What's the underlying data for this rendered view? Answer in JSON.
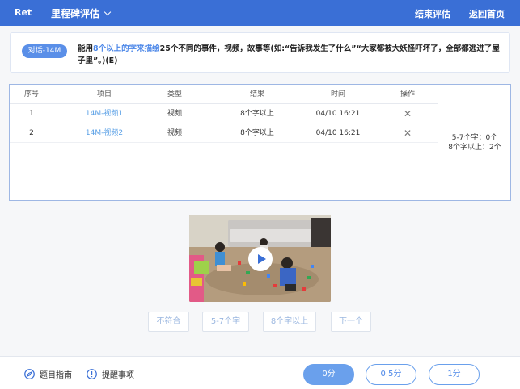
{
  "topbar": {
    "brand": "Ret",
    "menu": "里程碑评估",
    "end": "结束评估",
    "home": "返回首页"
  },
  "question": {
    "tag": "对话-14M",
    "text_pre": "能用",
    "text_hl": "8个以上的字来描绘",
    "text_post": "25个不同的事件，视频，故事等(如:“告诉我发生了什么”“大家都被大妖怪吓坏了，全部都逃进了屋子里”。)(E)"
  },
  "table": {
    "headers": [
      "序号",
      "项目",
      "类型",
      "结果",
      "时间",
      "操作"
    ],
    "rows": [
      {
        "no": "1",
        "item": "14M-视频1",
        "type": "视频",
        "result": "8个字以上",
        "time": "04/10 16:21",
        "action": "✕"
      },
      {
        "no": "2",
        "item": "14M-视频2",
        "type": "视频",
        "result": "8个字以上",
        "time": "04/10 16:21",
        "action": "✕"
      }
    ],
    "summary_line1": "5-7个字：0个",
    "summary_line2": "8个字以上：2个"
  },
  "options": [
    "不符合",
    "5-7个字",
    "8个字以上",
    "下一个"
  ],
  "bottom": {
    "guide": "题目指南",
    "remind": "提醒事项",
    "scores": [
      "0分",
      "0.5分",
      "1分"
    ],
    "selected_score": "0分"
  },
  "colors": {
    "accent": "#3a6fd6",
    "link": "#5aa0e6",
    "tag": "#5a8fe8"
  }
}
